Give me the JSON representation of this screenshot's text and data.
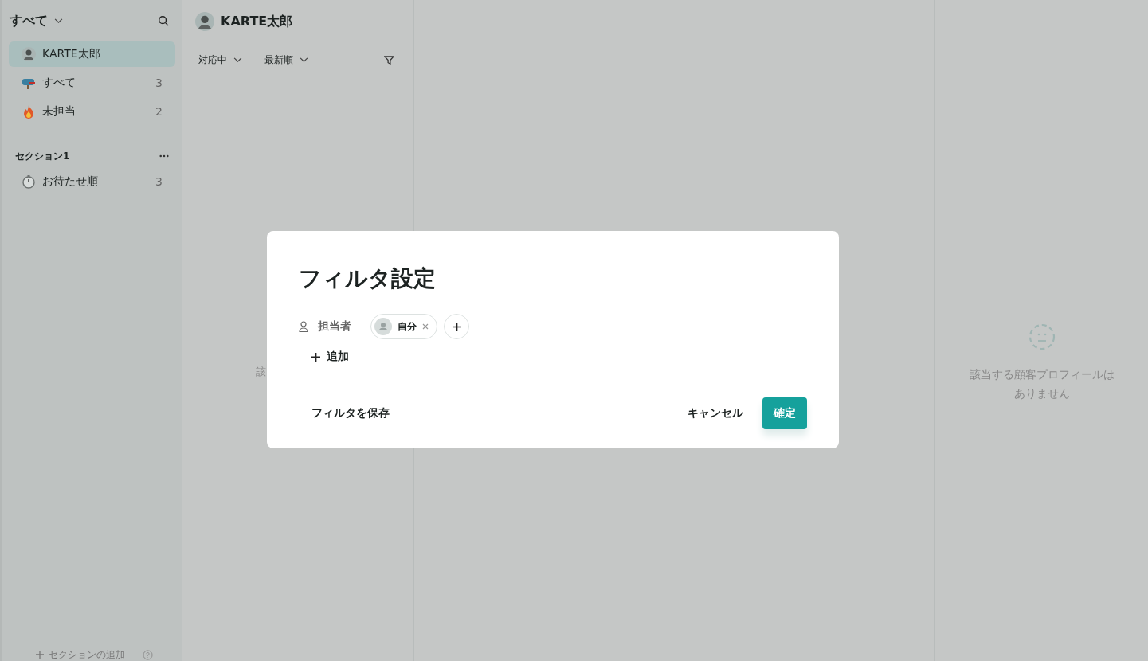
{
  "sidebar": {
    "title": "すべて",
    "items": [
      {
        "kind": "avatar",
        "label": "KARTE太郎",
        "selected": true
      },
      {
        "kind": "mailbox",
        "label": "すべて",
        "count": "3",
        "selected": false
      },
      {
        "kind": "fire",
        "label": "未担当",
        "count": "2",
        "selected": false
      }
    ],
    "sections": [
      {
        "title": "セクション1",
        "items": [
          {
            "kind": "stopwatch",
            "label": "お待たせ順",
            "count": "3",
            "selected": false
          }
        ]
      }
    ],
    "add_section": "セクションの追加"
  },
  "list": {
    "user_name": "KARTE太郎",
    "filters": [
      "対応中",
      "最新順"
    ],
    "empty_text": "該"
  },
  "detail": {
    "empty_text": "該当する顧客プロフィールはありません"
  },
  "modal": {
    "title": "フィルタ設定",
    "conditions": [
      {
        "label": "担当者",
        "chips": [
          {
            "label": "自分"
          }
        ]
      }
    ],
    "add_label": "追加",
    "save_label": "フィルタを保存",
    "cancel_label": "キャンセル",
    "confirm_label": "確定"
  }
}
